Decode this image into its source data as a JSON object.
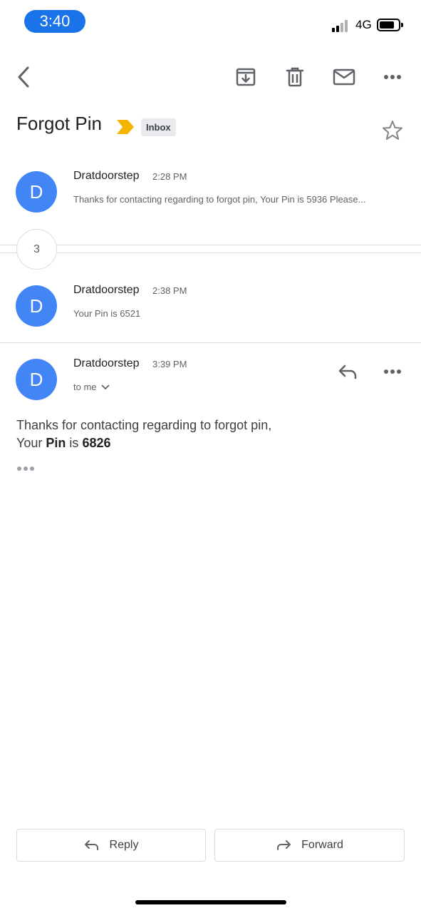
{
  "status_bar": {
    "time": "3:40",
    "network": "4G"
  },
  "toolbar": {
    "back_icon": "chevron-left-icon",
    "archive_icon": "archive-icon",
    "delete_icon": "trash-icon",
    "mark_unread_icon": "mail-icon",
    "more_icon": "more-horizontal-icon"
  },
  "thread": {
    "subject": "Forgot Pin",
    "label": "Inbox",
    "importance_color": "#f4b400"
  },
  "messages": [
    {
      "avatar": "D",
      "sender": "Dratdoorstep",
      "time": "2:28 PM",
      "snippet": "Thanks for contacting regarding to forgot pin, Your Pin is 5936 Please..."
    },
    {
      "avatar": "D",
      "sender": "Dratdoorstep",
      "time": "2:38 PM",
      "snippet": "Your Pin is 6521"
    },
    {
      "avatar": "D",
      "sender": "Dratdoorstep",
      "time": "3:39 PM",
      "recipient": "to me",
      "body_line1": "Thanks for contacting regarding to forgot pin,",
      "body_your": "Your",
      "body_pin": "Pin",
      "body_is": "is",
      "body_code": "6826"
    }
  ],
  "collapsed_count": "3",
  "actions": {
    "reply": "Reply",
    "forward": "Forward"
  },
  "colors": {
    "avatar": "#4285f4",
    "time_pill": "#1a73e8"
  }
}
